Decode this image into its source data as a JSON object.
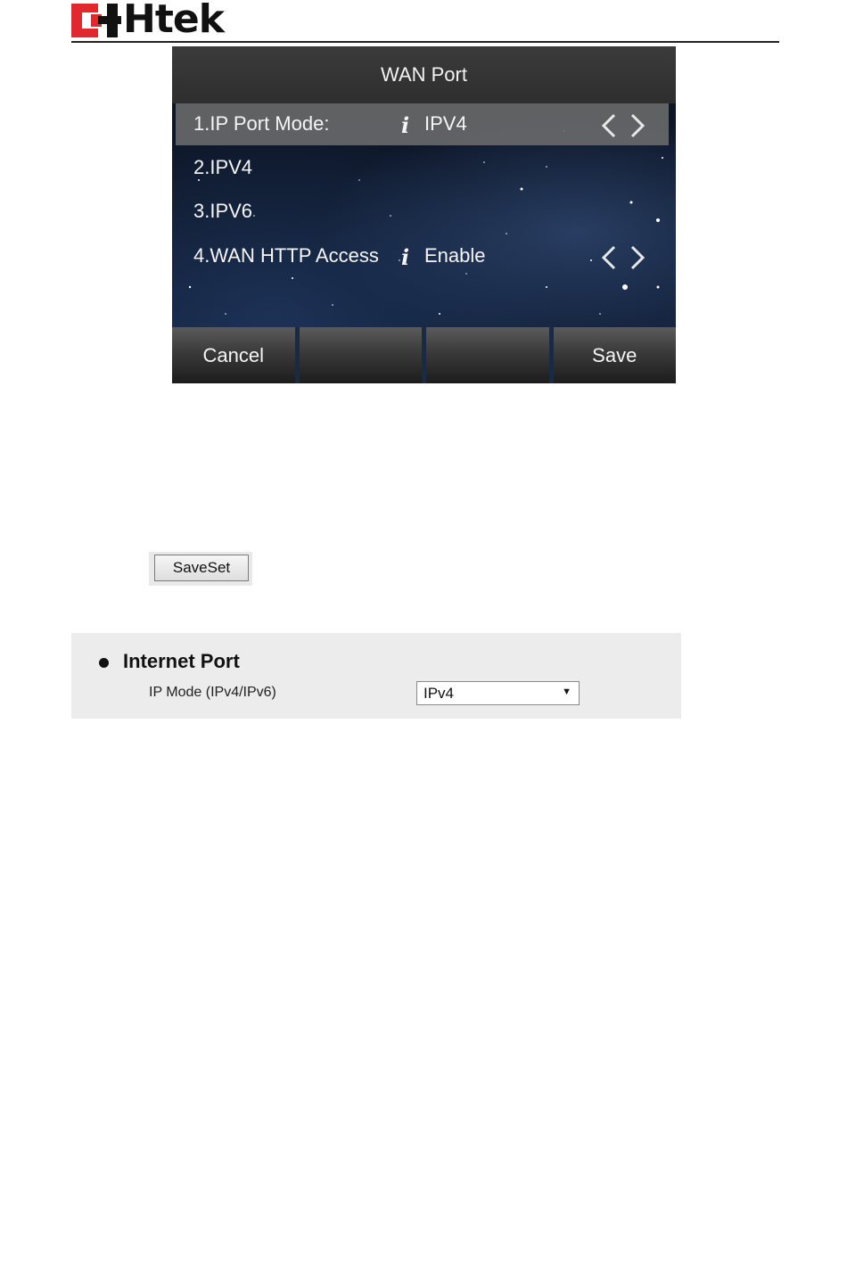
{
  "brand": {
    "logo_text": "Htek",
    "logo_red": "#e0282e"
  },
  "phone": {
    "title": "WAN Port",
    "rows": [
      {
        "label": "1.IP Port Mode:",
        "info": "i",
        "value": "IPV4",
        "selected": true
      },
      {
        "label": "2.IPV4"
      },
      {
        "label": "3.IPV6"
      },
      {
        "label": "4.WAN HTTP Access",
        "info": "i",
        "value": "Enable",
        "selected": false
      }
    ],
    "softkeys": [
      "Cancel",
      "",
      "",
      "Save"
    ]
  },
  "web": {
    "saveset_label": "SaveSet",
    "section_title": "Internet Port",
    "field_label": "IP Mode (IPv4/IPv6)",
    "field_value": "IPv4",
    "caret": "▼"
  }
}
